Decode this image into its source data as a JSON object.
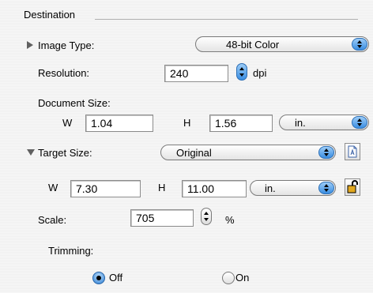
{
  "destination": {
    "title": "Destination"
  },
  "image_type": {
    "label": "Image Type:",
    "value": "48-bit Color"
  },
  "resolution": {
    "label": "Resolution:",
    "value": "240",
    "unit": "dpi"
  },
  "document_size": {
    "label": "Document Size:",
    "w_label": "W",
    "w_value": "1.04",
    "h_label": "H",
    "h_value": "1.56",
    "unit": "in."
  },
  "target_size": {
    "label": "Target Size:",
    "value": "Original",
    "w_label": "W",
    "w_value": "7.30",
    "h_label": "H",
    "h_value": "11.00",
    "unit": "in."
  },
  "scale": {
    "label": "Scale:",
    "value": "705",
    "unit": "%"
  },
  "trimming": {
    "label": "Trimming:",
    "options": [
      {
        "label": "Off",
        "selected": true
      },
      {
        "label": "On",
        "selected": false
      }
    ]
  },
  "icons": {
    "image_type_disclosure": "disclosure-triangle-right-icon",
    "target_size_disclosure": "disclosure-triangle-down-icon",
    "target_size_document": "document-icon",
    "target_size_lock": "padlock-icon"
  },
  "colors": {
    "accent": "#3a8ee2",
    "lock": "#d9a21c"
  }
}
